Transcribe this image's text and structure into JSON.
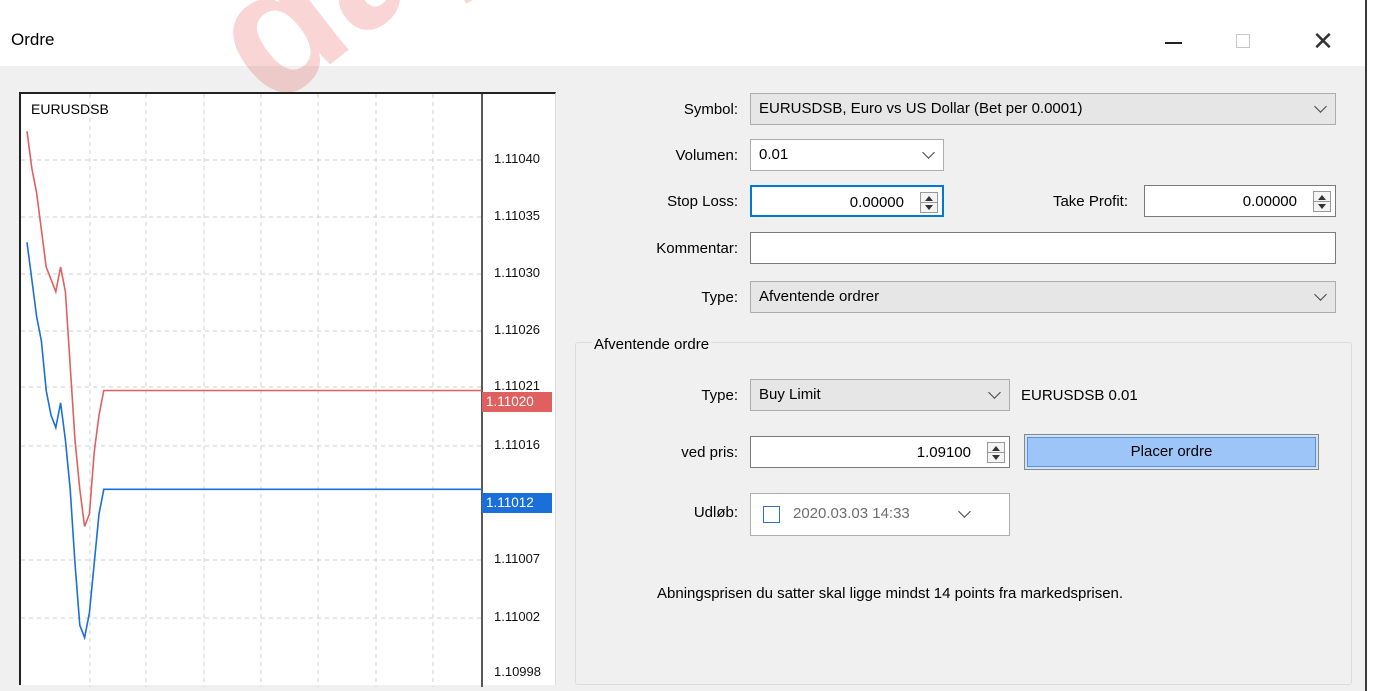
{
  "window": {
    "title": "Ordre"
  },
  "watermark": "dayt",
  "chart": {
    "symbol": "EURUSDSB",
    "ticks": [
      "1.11040",
      "1.11035",
      "1.11030",
      "1.11026",
      "1.11021",
      "1.11016",
      "1.11007",
      "1.11002",
      "1.10998"
    ],
    "ask_tag": "1.11020",
    "bid_tag": "1.11012"
  },
  "chart_data": {
    "type": "line",
    "title": "EURUSDSB",
    "ylim": [
      1.10996,
      1.11044
    ],
    "series": [
      {
        "color": "#e06060",
        "values": [
          1.11041,
          1.11038,
          1.11036,
          1.11033,
          1.1103,
          1.11029,
          1.11028,
          1.1103,
          1.11028,
          1.11022,
          1.11016,
          1.11012,
          1.11009,
          1.1101,
          1.11015,
          1.11018,
          1.1102,
          1.1102,
          1.1102,
          1.1102,
          1.1102
        ]
      },
      {
        "color": "#1b6fd8",
        "values": [
          1.11032,
          1.11029,
          1.11026,
          1.11024,
          1.1102,
          1.11018,
          1.11017,
          1.11019,
          1.11016,
          1.11012,
          1.11006,
          1.11001,
          1.11,
          1.11002,
          1.11006,
          1.1101,
          1.11012,
          1.11012,
          1.11012,
          1.11012,
          1.11012
        ]
      }
    ]
  },
  "form": {
    "symbol_label": "Symbol:",
    "symbol_value": "EURUSDSB, Euro vs US Dollar (Bet per 0.0001)",
    "volume_label": "Volumen:",
    "volume_value": "0.01",
    "stoploss_label": "Stop Loss:",
    "stoploss_value": "0.00000",
    "takeprofit_label": "Take Profit:",
    "takeprofit_value": "0.00000",
    "comment_label": "Kommentar:",
    "comment_value": "",
    "type_label": "Type:",
    "type_value": "Afventende ordrer"
  },
  "pending": {
    "group_title": "Afventende ordre",
    "type_label": "Type:",
    "type_value": "Buy Limit",
    "summary": "EURUSDSB 0.01",
    "price_label": "ved pris:",
    "price_value": "1.09100",
    "place_button": "Placer ordre",
    "expiry_label": "Udløb:",
    "expiry_value": "2020.03.03 14:33",
    "note": "Abningsprisen du satter skal ligge mindst 14 points fra markedsprisen."
  }
}
